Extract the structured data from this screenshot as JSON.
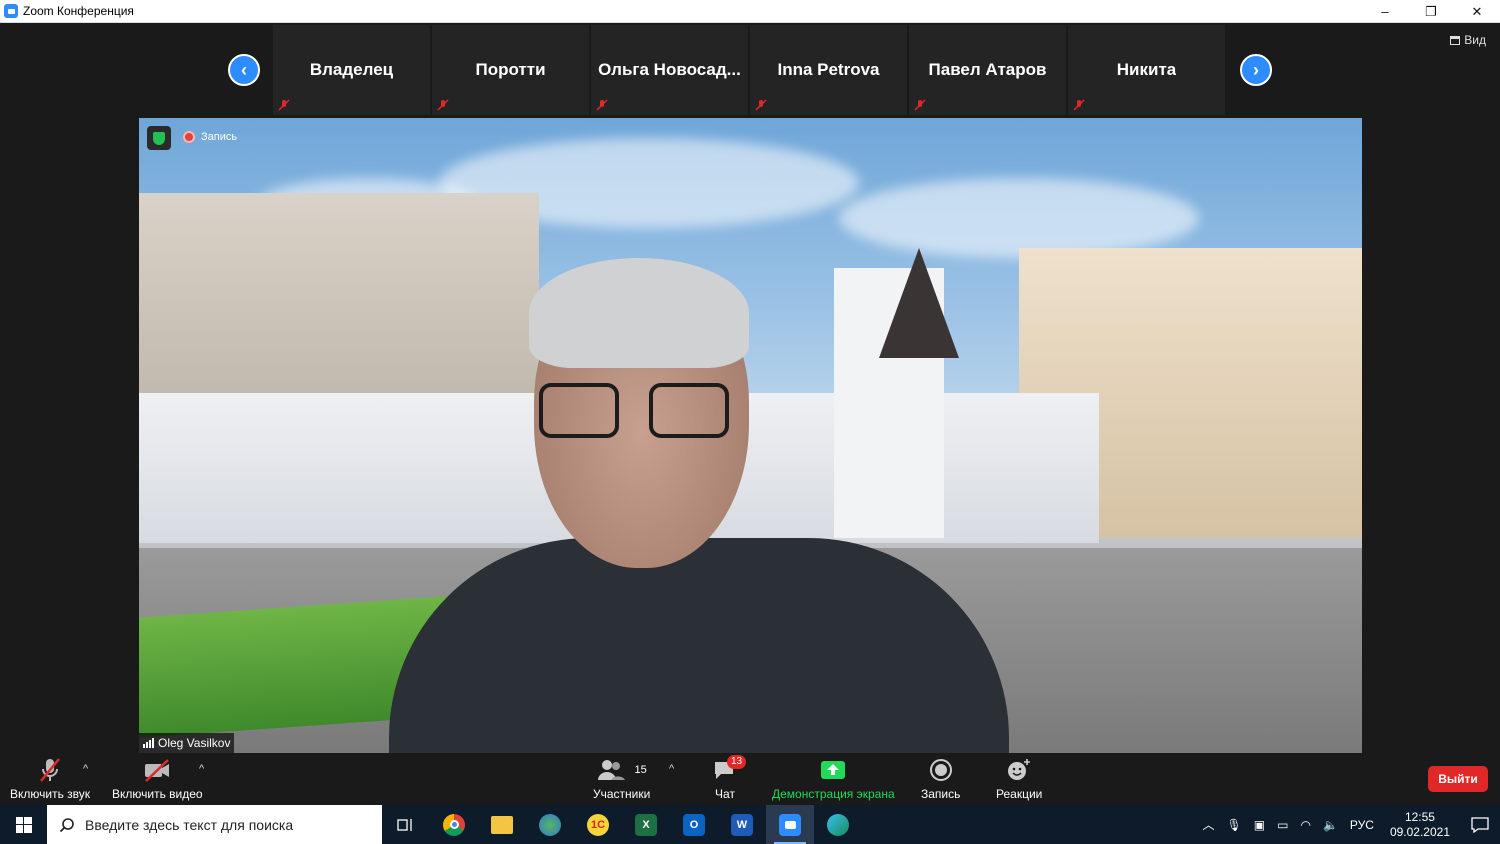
{
  "window": {
    "title": "Zoom Конференция",
    "controls": [
      "–",
      "❐",
      "✕"
    ]
  },
  "view_button": {
    "label": "Вид"
  },
  "gallery": {
    "participants": [
      {
        "name": "Владелец"
      },
      {
        "name": "Поротти"
      },
      {
        "name": "Ольга  Новосад..."
      },
      {
        "name": "Inna Petrova"
      },
      {
        "name": "Павел Атаров"
      },
      {
        "name": "Никита"
      }
    ],
    "prev_arrow": "‹",
    "next_arrow": "›"
  },
  "video": {
    "recording_label": "Запись",
    "speaker_name": "Oleg Vasilkov"
  },
  "toolbar": {
    "audio_label": "Включить звук",
    "video_label": "Включить видео",
    "participants_label": "Участники",
    "participants_count": "15",
    "chat_label": "Чат",
    "chat_badge": "13",
    "share_label": "Демонстрация экрана",
    "record_label": "Запись",
    "reactions_label": "Реакции",
    "leave_label": "Выйти",
    "caret": "^"
  },
  "colors": {
    "accent": "#2d8cff",
    "share_green": "#23d959",
    "danger": "#e02828"
  },
  "taskbar": {
    "search_placeholder": "Введите здесь текст для поиска",
    "apps": [
      {
        "name": "task-view"
      },
      {
        "name": "chrome"
      },
      {
        "name": "file-explorer"
      },
      {
        "name": "maps"
      },
      {
        "name": "1c"
      },
      {
        "name": "excel",
        "glyph": "X"
      },
      {
        "name": "outlook",
        "glyph": "O"
      },
      {
        "name": "word",
        "glyph": "W"
      },
      {
        "name": "zoom"
      },
      {
        "name": "edge"
      }
    ],
    "language": "РУС",
    "time": "12:55",
    "date": "09.02.2021"
  }
}
